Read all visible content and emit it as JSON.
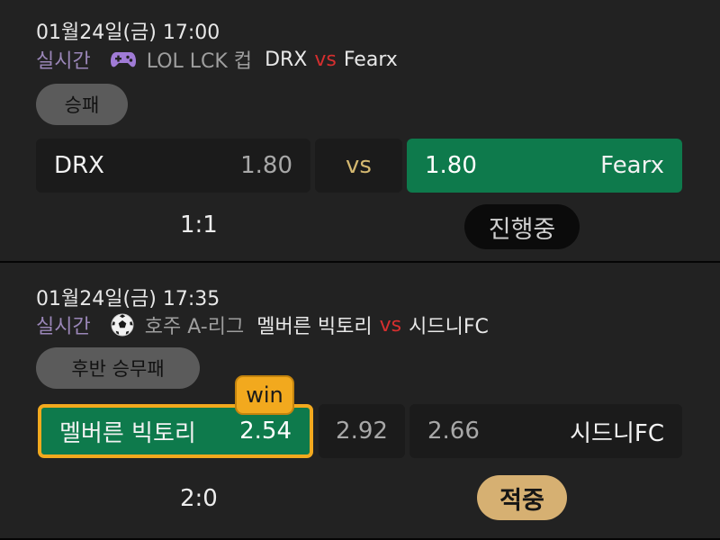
{
  "matches": [
    {
      "datetime": "01월24일(금) 17:00",
      "live_label": "실시간",
      "league_icon": "gamepad-icon",
      "league": "LOL LCK 컵",
      "home_team": "DRX",
      "vs": "vs",
      "away_team": "Fearx",
      "bet_type": "승패",
      "home_name": "DRX",
      "home_odds": "1.80",
      "mid_label": "vs",
      "away_odds": "1.80",
      "away_name": "Fearx",
      "score": "1:1",
      "status": "진행중"
    },
    {
      "datetime": "01월24일(금) 17:35",
      "live_label": "실시간",
      "league_icon": "soccer-ball-icon",
      "league": "호주 A-리그",
      "home_team": "멜버른 빅토리",
      "vs": "vs",
      "away_team": "시드니FC",
      "bet_type": "후반 승무패",
      "home_name": "멜버른 빅토리",
      "home_odds": "2.54",
      "draw_odds": "2.92",
      "away_odds": "2.66",
      "away_name": "시드니FC",
      "win_tag": "win",
      "score": "2:0",
      "status": "적중"
    }
  ],
  "colors": {
    "background": "#222222",
    "selected_green": "#0e7a4c",
    "win_orange": "#f2a91e",
    "vs_red": "#d62f2f",
    "hit_gold": "#d6b072"
  }
}
